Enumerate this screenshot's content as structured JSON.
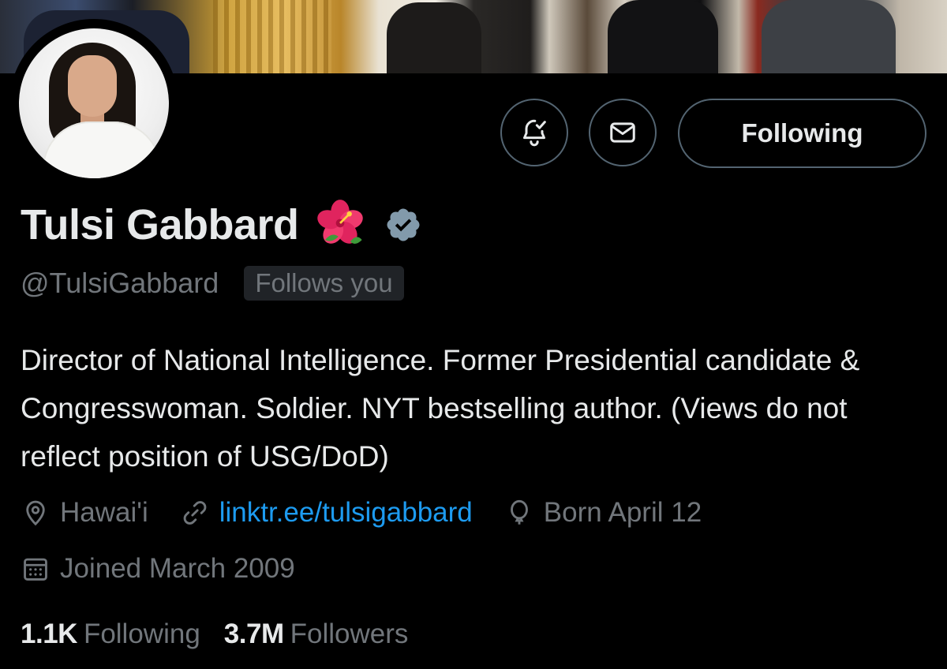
{
  "profile": {
    "name": "Tulsi Gabbard",
    "handle": "@TulsiGabbard",
    "follows_you": "Follows you",
    "bio": "Director of National Intelligence. Former Presidential candidate & Congresswoman. Soldier. NYT bestselling author. (Views do not reflect position of USG/DoD)",
    "location": "Hawai'i",
    "website": "linktr.ee/tulsigabbard",
    "birthday": "Born April 12",
    "joined": "Joined March 2009"
  },
  "actions": {
    "following_label": "Following",
    "notify_icon": "bell-check-icon",
    "message_icon": "envelope-icon"
  },
  "stats": {
    "following_count": "1.1K",
    "following_label": "Following",
    "followers_count": "3.7M",
    "followers_label": "Followers"
  },
  "colors": {
    "background": "#000000",
    "primary_text": "#e7e9ea",
    "secondary_text": "#71767b",
    "link": "#1d9bf0",
    "border": "#536471",
    "verified": "#829aab"
  }
}
